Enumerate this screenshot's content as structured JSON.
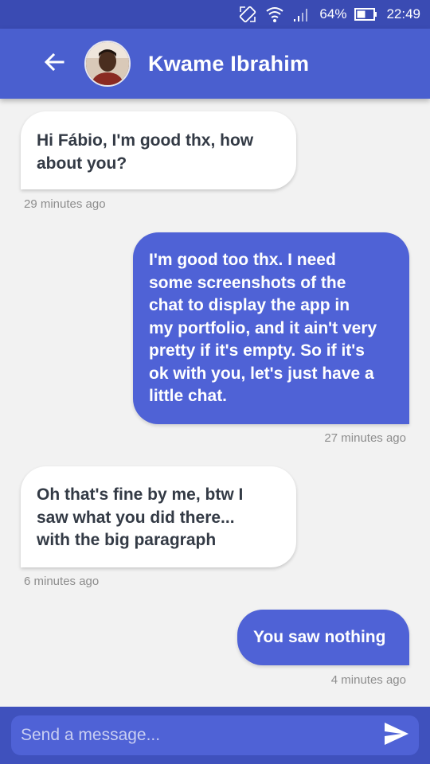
{
  "status_bar": {
    "battery": "64%",
    "time": "22:49",
    "icons": [
      "rotate-icon",
      "wifi-icon",
      "signal-icon",
      "battery-icon"
    ]
  },
  "header": {
    "back_icon": "arrow-left-icon",
    "contact_name": "Kwame Ibrahim",
    "avatar": "avatar"
  },
  "messages": [
    {
      "direction": "in",
      "text_lines": [
        "Hi Fábio, I'm good thx, how",
        "about you?"
      ],
      "time": "29 minutes ago"
    },
    {
      "direction": "out",
      "text_lines": [
        "I'm good too thx. I need",
        "some screenshots of the",
        "chat to display the app in",
        "my portfolio, and it ain't very",
        "pretty if it's empty. So if it's",
        "ok with you, let's just have a",
        "little chat."
      ],
      "time": "27 minutes ago"
    },
    {
      "direction": "in",
      "text_lines": [
        "Oh that's fine by me, btw I",
        "saw what you did there...",
        "with the big paragraph"
      ],
      "time": "6 minutes ago"
    },
    {
      "direction": "out",
      "text_lines": [
        "You saw nothing"
      ],
      "time": "4 minutes ago"
    }
  ],
  "composer": {
    "placeholder": "Send a message...",
    "value": "",
    "send_icon": "send-icon"
  },
  "colors": {
    "status_bar": "#3a4bb3",
    "app_bar": "#4a5fcf",
    "outgoing_bubble": "#4f62d6",
    "incoming_bubble": "#ffffff",
    "background": "#f2f2f2"
  }
}
